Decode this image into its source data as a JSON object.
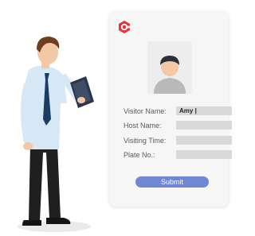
{
  "form": {
    "fields": [
      {
        "label": "Visitor Name:",
        "value": "Amy |"
      },
      {
        "label": "Host Name:",
        "value": ""
      },
      {
        "label": "Visiting Time:",
        "value": ""
      },
      {
        "label": "Plate No.:",
        "value": ""
      }
    ],
    "submit_label": "Submit"
  },
  "icons": {
    "logo": "brand-logo-icon",
    "photo": "visitor-avatar-icon"
  },
  "colors": {
    "brand_red": "#e8313a",
    "submit_blue": "#7087d3",
    "card_bg": "#f6f6f6",
    "input_bg": "#d9d9d9"
  }
}
